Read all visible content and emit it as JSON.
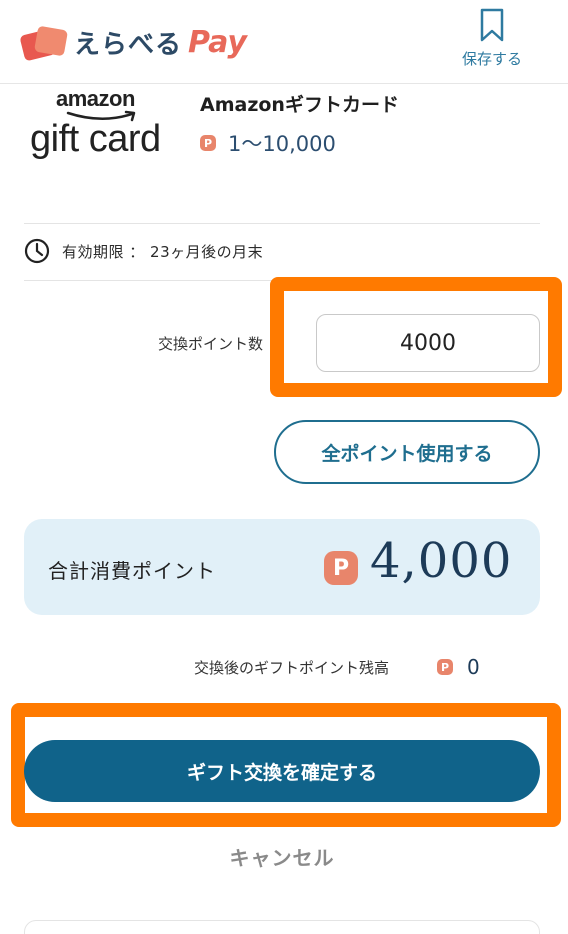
{
  "header": {
    "logo_text": "えらべる",
    "logo_pay": "Pay",
    "save_label": "保存する"
  },
  "product": {
    "brand_top": "amazon",
    "brand_bottom": "gift card",
    "name": "Amazonギフトカード",
    "point_icon": "P",
    "range": "1〜10,000"
  },
  "expiry": {
    "text": "有効期限 ： 23ヶ月後の月末"
  },
  "exchange": {
    "label": "交換ポイント数",
    "value": "4000",
    "all_points_button": "全ポイント使用する"
  },
  "total": {
    "label": "合計消費ポイント",
    "point_icon": "P",
    "value": "4,000"
  },
  "remaining": {
    "label": "交換後のギフトポイント残高",
    "point_icon": "P",
    "value": "0"
  },
  "actions": {
    "confirm": "ギフト交換を確定する",
    "cancel": "キャンセル"
  },
  "colors": {
    "accent": "#10638a",
    "highlight": "#ff7a00",
    "point_badge": "#e8856b",
    "total_bg": "#e1f0f8"
  }
}
